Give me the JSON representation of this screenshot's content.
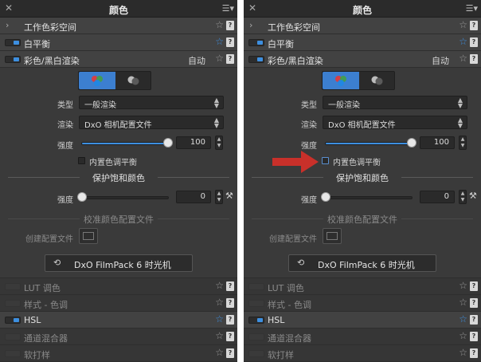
{
  "panel": {
    "title": "颜色",
    "close_glyph": "✕",
    "menu_glyph": "☰▾"
  },
  "rows": {
    "working_space": {
      "label": "工作色彩空间",
      "expanded": false
    },
    "white_balance": {
      "label": "白平衡",
      "enabled": true,
      "favorite": true
    },
    "color_bw": {
      "label": "彩色/黑白渲染",
      "value": "自动",
      "enabled": true
    }
  },
  "rendering": {
    "mode_buttons": [
      {
        "name": "color",
        "icon": "rgb-circles-icon",
        "active": true
      },
      {
        "name": "bw",
        "icon": "bw-circles-icon",
        "active": false
      }
    ],
    "type_label": "类型",
    "type_value": "一般渲染",
    "render_label": "渲染",
    "render_value": "DxO 相机配置文件",
    "intensity_label": "强度",
    "intensity_value": "100",
    "intensity_fraction": 1.0,
    "builtin_wb_label": "内置色调平衡",
    "builtin_wb_checked": false
  },
  "protect": {
    "header": "保护饱和颜色",
    "intensity_label": "强度",
    "intensity_value": "0",
    "intensity_fraction": 0.0
  },
  "calibration": {
    "header": "校准颜色配置文件",
    "create_profile_label": "创建配置文件"
  },
  "filmpack_button": "DxO FilmPack 6 时光机",
  "modules": [
    {
      "label": "LUT 调色",
      "enabled": false,
      "dim": true,
      "favorite": false
    },
    {
      "label": "样式 - 色调",
      "enabled": false,
      "dim": true,
      "favorite": false
    },
    {
      "label": "HSL",
      "enabled": true,
      "dim": false,
      "favorite": true
    },
    {
      "label": "通道混合器",
      "enabled": false,
      "dim": true,
      "favorite": false
    },
    {
      "label": "软打样",
      "enabled": false,
      "dim": true,
      "favorite": false
    }
  ],
  "colors": {
    "accent": "#3d8fe0",
    "annotation_arrow": "#c8302a"
  },
  "icons": {
    "star": "☆",
    "help": "?",
    "chevron": "›",
    "wand": "⚒",
    "filmpack": "⟲"
  }
}
